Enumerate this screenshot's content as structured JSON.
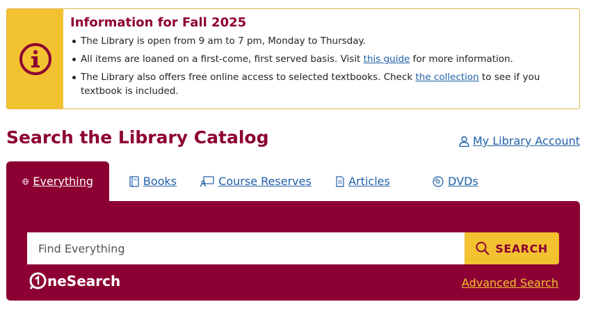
{
  "alert": {
    "title": "Information for Fall 2025",
    "icon": "info-circle-icon",
    "items": [
      {
        "text": "The Library is open from 9 am to 7 pm, Monday to Thursday."
      },
      {
        "before": "All items are loaned on a first-come, first served basis. Visit ",
        "link": "this guide",
        "after": " for more information."
      },
      {
        "before": "The Library also offers free online access to selected textbooks. Check ",
        "link": "the collection",
        "after": " to see if you textbook is included."
      }
    ]
  },
  "heading": "Search the Library Catalog",
  "account_link": "My Library Account",
  "tabs": [
    {
      "label": "Everything",
      "icon": "globe-icon",
      "active": true
    },
    {
      "label": "Books",
      "icon": "book-icon",
      "active": false
    },
    {
      "label": "Course Reserves",
      "icon": "reserves-icon",
      "active": false
    },
    {
      "label": "Articles",
      "icon": "document-icon",
      "active": false
    },
    {
      "label": "DVDs",
      "icon": "disc-icon",
      "active": false
    }
  ],
  "search": {
    "placeholder": "Find Everything",
    "button_label": "SEARCH"
  },
  "logo": {
    "text": "neSearch"
  },
  "advanced_link": "Advanced Search",
  "colors": {
    "maroon": "#8c0033",
    "gold": "#f2c230",
    "link": "#1f5fa8"
  }
}
